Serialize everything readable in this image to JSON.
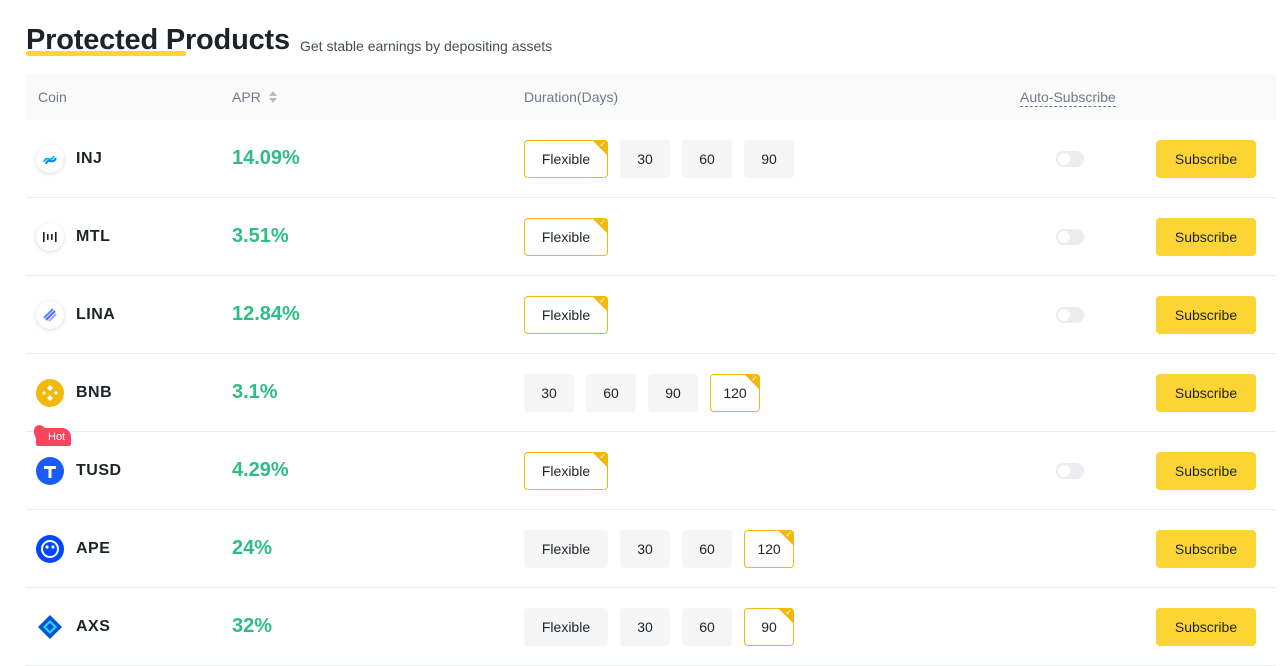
{
  "header": {
    "title": "Protected Products",
    "subtitle": "Get stable earnings by depositing assets"
  },
  "columns": {
    "coin": "Coin",
    "apr": "APR",
    "duration": "Duration(Days)",
    "auto_subscribe": "Auto-Subscribe"
  },
  "colors": {
    "accent": "#fcd535",
    "apr_green": "#2ebd85",
    "selected_border": "#f0b90b",
    "hot_red": "#f6465d"
  },
  "rows": [
    {
      "coin": "INJ",
      "icon": "inj-icon",
      "apr": "14.09%",
      "durations": [
        "Flexible",
        "30",
        "60",
        "90"
      ],
      "selected": 0,
      "auto_subscribe": false,
      "has_toggle": true,
      "hot": false,
      "button": "Subscribe"
    },
    {
      "coin": "MTL",
      "icon": "mtl-icon",
      "apr": "3.51%",
      "durations": [
        "Flexible"
      ],
      "selected": 0,
      "auto_subscribe": false,
      "has_toggle": true,
      "hot": false,
      "button": "Subscribe"
    },
    {
      "coin": "LINA",
      "icon": "lina-icon",
      "apr": "12.84%",
      "durations": [
        "Flexible"
      ],
      "selected": 0,
      "auto_subscribe": false,
      "has_toggle": true,
      "hot": false,
      "button": "Subscribe"
    },
    {
      "coin": "BNB",
      "icon": "bnb-icon",
      "apr": "3.1%",
      "durations": [
        "30",
        "60",
        "90",
        "120"
      ],
      "selected": 3,
      "auto_subscribe": false,
      "has_toggle": false,
      "hot": false,
      "button": "Subscribe"
    },
    {
      "coin": "TUSD",
      "icon": "tusd-icon",
      "apr": "4.29%",
      "durations": [
        "Flexible"
      ],
      "selected": 0,
      "auto_subscribe": false,
      "has_toggle": true,
      "hot": true,
      "hot_label": "Hot",
      "button": "Subscribe"
    },
    {
      "coin": "APE",
      "icon": "ape-icon",
      "apr": "24%",
      "durations": [
        "Flexible",
        "30",
        "60",
        "120"
      ],
      "selected": 3,
      "auto_subscribe": false,
      "has_toggle": false,
      "hot": false,
      "button": "Subscribe"
    },
    {
      "coin": "AXS",
      "icon": "axs-icon",
      "apr": "32%",
      "durations": [
        "Flexible",
        "30",
        "60",
        "90"
      ],
      "selected": 3,
      "auto_subscribe": false,
      "has_toggle": false,
      "hot": false,
      "button": "Subscribe"
    }
  ]
}
